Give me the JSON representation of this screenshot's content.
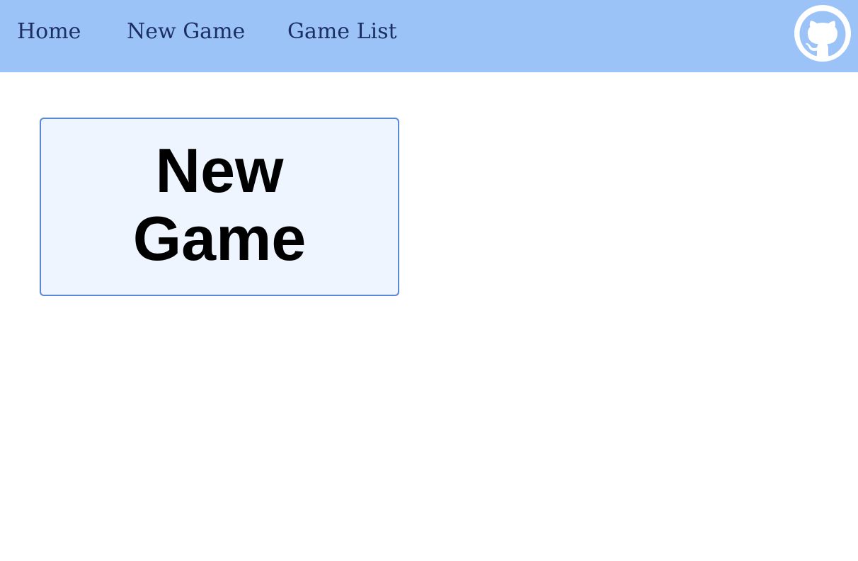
{
  "nav": {
    "items": [
      {
        "label": "Home"
      },
      {
        "label": "New Game"
      },
      {
        "label": "Game List"
      }
    ],
    "github_icon": "github-icon"
  },
  "main": {
    "card": {
      "title": "New Game"
    }
  },
  "colors": {
    "header_bg": "#9cc3f7",
    "nav_text": "#1b2f63",
    "card_bg": "#eef5ff",
    "card_border": "#5a88d8"
  }
}
